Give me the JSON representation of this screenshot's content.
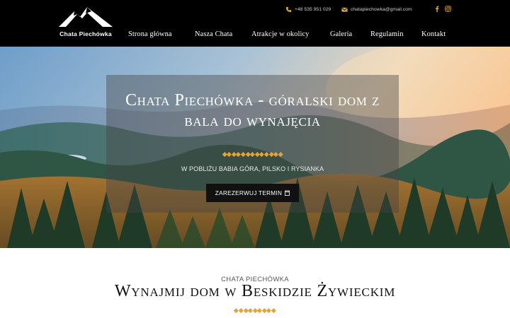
{
  "brand": {
    "name": "Chata Piechówka"
  },
  "contact": {
    "phone": "+48 535 951 029",
    "email": "chatapiechowka@gmail.com"
  },
  "social": {
    "icons": [
      "facebook-icon",
      "instagram-icon"
    ]
  },
  "nav": {
    "items": [
      {
        "label": "Strona główna"
      },
      {
        "label": "Nasza Chata"
      },
      {
        "label": "Atrakcje w okolicy"
      },
      {
        "label": "Galeria"
      },
      {
        "label": "Regulamin"
      },
      {
        "label": "Kontakt"
      }
    ]
  },
  "hero": {
    "title": "Chata Piechówka - góralski dom z bala do wynajęcia",
    "subtitle": "W POBLIŻU BABIA GÓRA, PILSKO I RYSIANKA",
    "button_label": "ZAREZERWUJ TERMIN",
    "button_icon": "calendar-icon"
  },
  "section": {
    "kicker": "CHATA PIECHÓWKA",
    "title": "Wynajmij dom w Beskidzie Żywieckim"
  },
  "colors": {
    "header_bg": "#000000",
    "accent": "#e3a33b",
    "button_bg": "#111111"
  }
}
